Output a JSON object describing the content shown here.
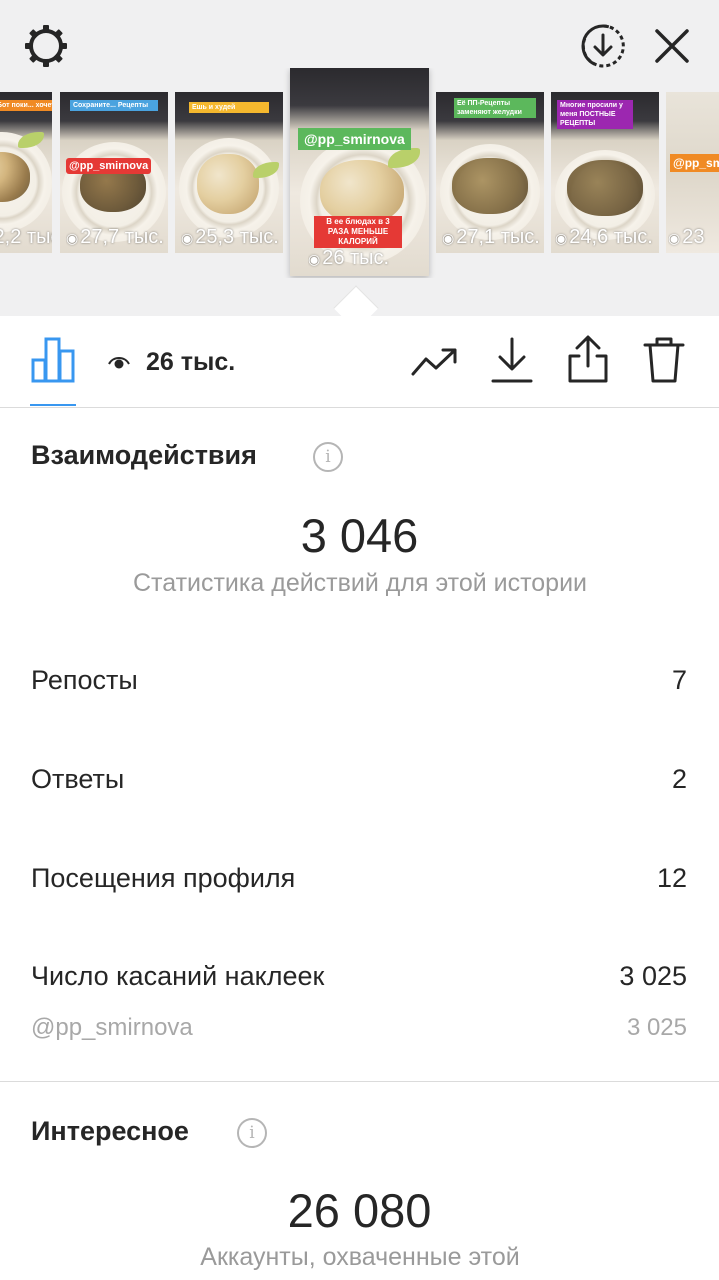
{
  "header": {
    "settings_icon": "gear-icon",
    "download_circle_icon": "download-circle-icon",
    "close_icon": "close-icon"
  },
  "stories": [
    {
      "views": "2,2 тыс.",
      "tag": "Бот поки... хочет к чаю",
      "tag_color": "#f08a24"
    },
    {
      "views": "27,7 тыс.",
      "tag": "Сохраните... Рецепты",
      "tag2": "@pp_smirnova",
      "tag_color": "#4aa3df",
      "tag2_color": "#e53935"
    },
    {
      "views": "25,3 тыс.",
      "tag": "Ешь и худей",
      "tag_color": "#f5b82e"
    },
    {
      "views": "26 тыс.",
      "tag": "@pp_smirnova",
      "tag2": "В ее блюдах в 3 РАЗА МЕНЬШЕ КАЛОРИЙ",
      "tag_color": "#5cb85c",
      "tag2_color": "#e53935"
    },
    {
      "views": "27,1 тыс.",
      "tag": "Её ПП-Рецепты заменяют желудки",
      "tag_color": "#5cb85c"
    },
    {
      "views": "24,6 тыс.",
      "tag": "Многие просили у меня ПОСТНЫЕ РЕЦЕПТЫ",
      "tag_color": "#9c27b0"
    },
    {
      "views": "23",
      "tag": "@pp_sm",
      "tag_color": "#f08a24"
    }
  ],
  "toolbar": {
    "insights_icon": "bar-chart-icon",
    "eye_icon": "eye-icon",
    "views_label": "26 тыс.",
    "trend_icon": "trending-up-icon",
    "download_icon": "download-icon",
    "share_icon": "share-icon",
    "trash_icon": "trash-icon"
  },
  "interactions": {
    "title": "Взаимодействия",
    "total": "3 046",
    "caption": "Статистика действий для этой истории",
    "rows": [
      {
        "label": "Репосты",
        "value": "7"
      },
      {
        "label": "Ответы",
        "value": "2"
      },
      {
        "label": "Посещения профиля",
        "value": "12"
      },
      {
        "label": "Число касаний наклеек",
        "value": "3 025"
      }
    ],
    "sub_row": {
      "label": "@pp_smirnova",
      "value": "3 025"
    }
  },
  "discovery": {
    "title": "Интересное",
    "total": "26 080",
    "caption": "Аккаунты, охваченные этой"
  },
  "colors": {
    "accent": "#3897f0",
    "text": "#262626",
    "muted": "#9a9a9a",
    "top_bg": "#f0f0f1"
  }
}
